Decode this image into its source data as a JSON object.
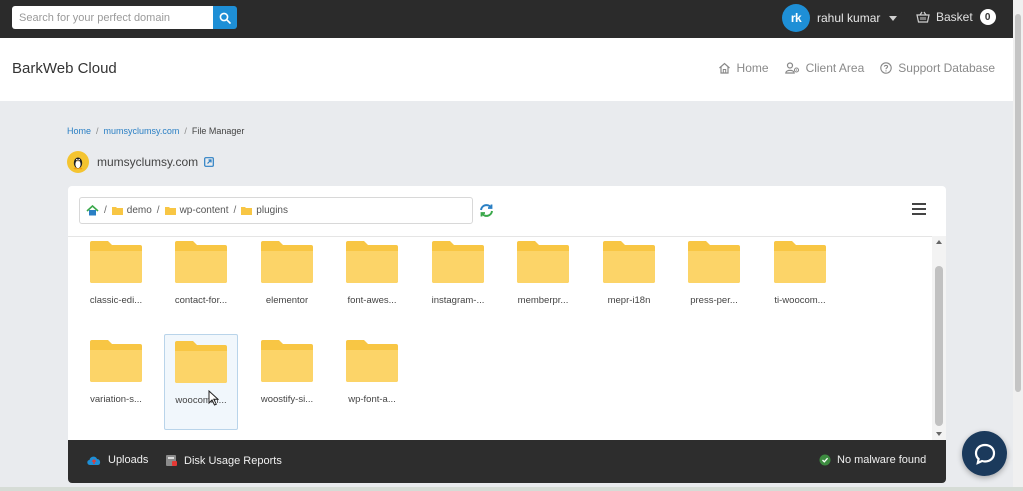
{
  "topbar": {
    "search_placeholder": "Search for your perfect domain",
    "user_initials": "rk",
    "user_name": "rahul kumar",
    "basket_label": "Basket",
    "basket_count": "0"
  },
  "header": {
    "brand": "BarkWeb Cloud",
    "nav": [
      {
        "label": "Home",
        "icon": "home-icon"
      },
      {
        "label": "Client Area",
        "icon": "user-gear-icon"
      },
      {
        "label": "Support Database",
        "icon": "question-circle-icon"
      }
    ]
  },
  "breadcrumb": {
    "items": [
      "Home",
      "mumsyclumsy.com",
      "File Manager"
    ]
  },
  "site": {
    "name": "mumsyclumsy.com"
  },
  "file_manager": {
    "path": [
      "demo",
      "wp-content",
      "plugins"
    ],
    "folders": [
      "classic-edi...",
      "contact-for...",
      "elementor",
      "font-awes...",
      "instagram-...",
      "memberpr...",
      "mepr-i18n",
      "press-per...",
      "ti-woocom...",
      "variation-s...",
      "woocomm...",
      "woostify-si...",
      "wp-font-a..."
    ],
    "selected_folder": "woocomm...",
    "footer": {
      "uploads": "Uploads",
      "disk_usage": "Disk Usage Reports",
      "malware": "No malware found"
    }
  },
  "colors": {
    "accent": "#1e8fd6",
    "folder": "#fcd468",
    "dark_bar": "#2b2b2b",
    "footer_bar": "#2d2d2d"
  }
}
